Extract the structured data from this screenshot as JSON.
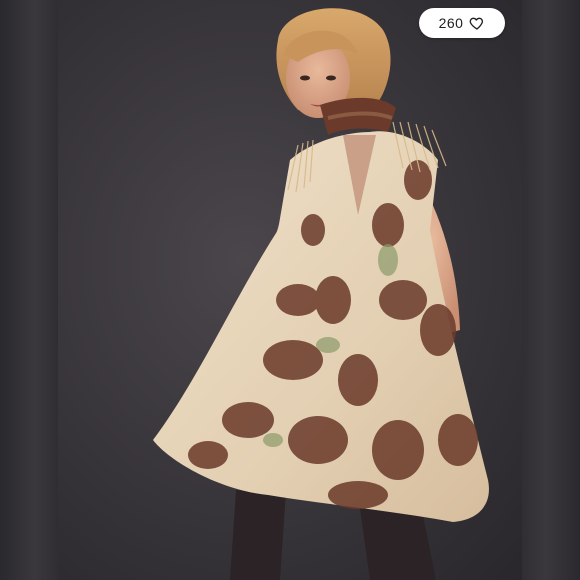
{
  "listing": {
    "likes": "260",
    "like_icon": "heart-outline-icon"
  },
  "colors": {
    "background": "#38353a",
    "dress_base": "#e8d6bf",
    "dye_brown": "#6b3a2a",
    "dye_green": "#8c9a6a",
    "pill": "#ffffff"
  }
}
